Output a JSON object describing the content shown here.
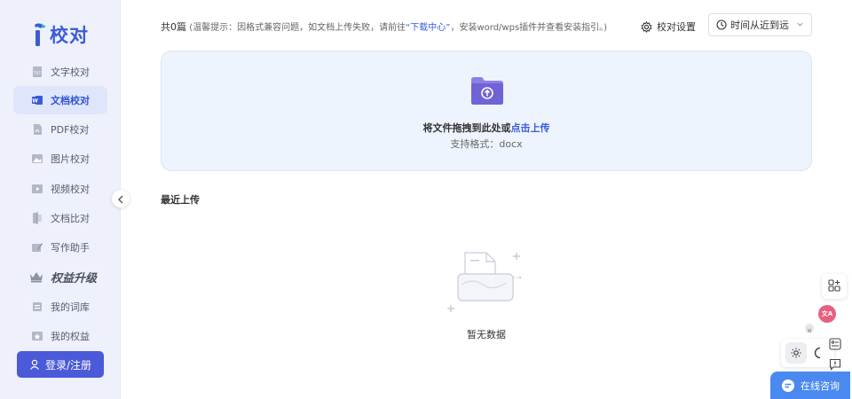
{
  "app": {
    "logo_text": "校对",
    "logo_mark": "i"
  },
  "sidebar": {
    "items": [
      {
        "label": "文字校对",
        "icon": "text-doc-icon"
      },
      {
        "label": "文档校对",
        "icon": "word-doc-icon",
        "active": true
      },
      {
        "label": "PDF校对",
        "icon": "pdf-icon"
      },
      {
        "label": "图片校对",
        "icon": "image-icon"
      },
      {
        "label": "视频校对",
        "icon": "video-icon"
      },
      {
        "label": "文档比对",
        "icon": "compare-icon"
      },
      {
        "label": "写作助手",
        "icon": "pen-icon"
      }
    ],
    "upgrade_label": "权益升级",
    "items2": [
      {
        "label": "我的词库",
        "icon": "dictionary-icon"
      },
      {
        "label": "我的权益",
        "icon": "star-badge-icon"
      }
    ],
    "login_label": "登录/注册"
  },
  "header": {
    "count_text": "共0篇",
    "notice_prefix": "(温馨提示：因格式兼容问题，如文档上传失败，请前往",
    "notice_link": "“下载中心”",
    "notice_suffix": "，安装word/wps插件并查看安装指引。)",
    "settings_label": "校对设置",
    "sort_value": "时间从近到远"
  },
  "dropzone": {
    "title_main": "将文件拖拽到此处或",
    "title_link": "点击上传",
    "formats": "支持格式：docx"
  },
  "recent": {
    "title": "最近上传",
    "empty_text": "暂无数据"
  },
  "float": {
    "consult_label": "在线咨询",
    "translate_glyph": "文A"
  },
  "colors": {
    "accent": "#3a5bd9",
    "sidebar_bg": "#eef1fb",
    "dropzone_bg": "#eef4fe",
    "login_bg": "#4a5ad8",
    "consult_bg": "#4a8af0",
    "translate_bg": "#e86080"
  }
}
